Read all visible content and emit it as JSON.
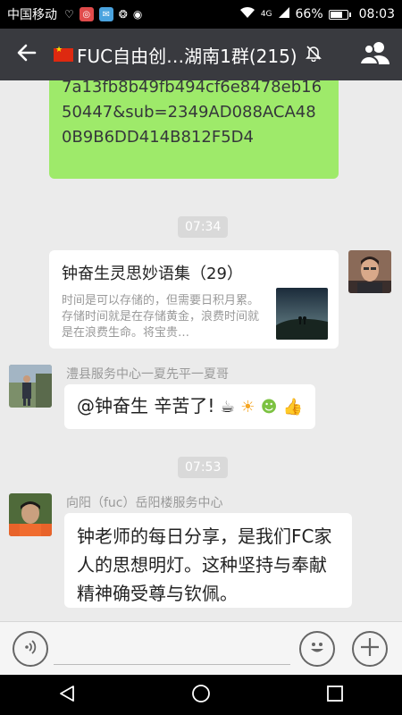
{
  "statusbar": {
    "carrier": "中国移动",
    "signal_tag": "4G",
    "battery_text": "66%",
    "battery_level": 0.66,
    "time": "08:03"
  },
  "header": {
    "title": "FUC自由创…湖南1群(215)",
    "icons": [
      "back-arrow-icon",
      "flag-icon",
      "mute-bell-icon",
      "members-icon"
    ]
  },
  "messages": {
    "link_msg_text": "7a13fb8b49fb494cf6e8478eb1650447&sub=2349AD088ACA480B9B6DD414B812F5D4",
    "time1": "07:34",
    "card": {
      "title": "钟奋生灵思妙语集（29）",
      "desc": "时间是可以存储的，但需要日积月累。存储时间就是在存储黄金，浪费时间就是在浪费生命。将宝贵…"
    },
    "msg2": {
      "sender": "澧县服务中心一夏先平一夏哥",
      "text": "@钟奋生 辛苦了!"
    },
    "time2": "07:53",
    "msg3": {
      "sender": "向阳（fuc）岳阳楼服务中心",
      "text": "钟老师的每日分享，是我们FC家人的思想明灯。这种坚持与奉献精神确受尊与钦佩。"
    }
  },
  "inputbar": {
    "input_value": ""
  },
  "colors": {
    "titlebar": "#393a3f",
    "chat_bg": "#ebebeb",
    "bubble_green": "#9eea6a",
    "bubble_white": "#ffffff"
  }
}
